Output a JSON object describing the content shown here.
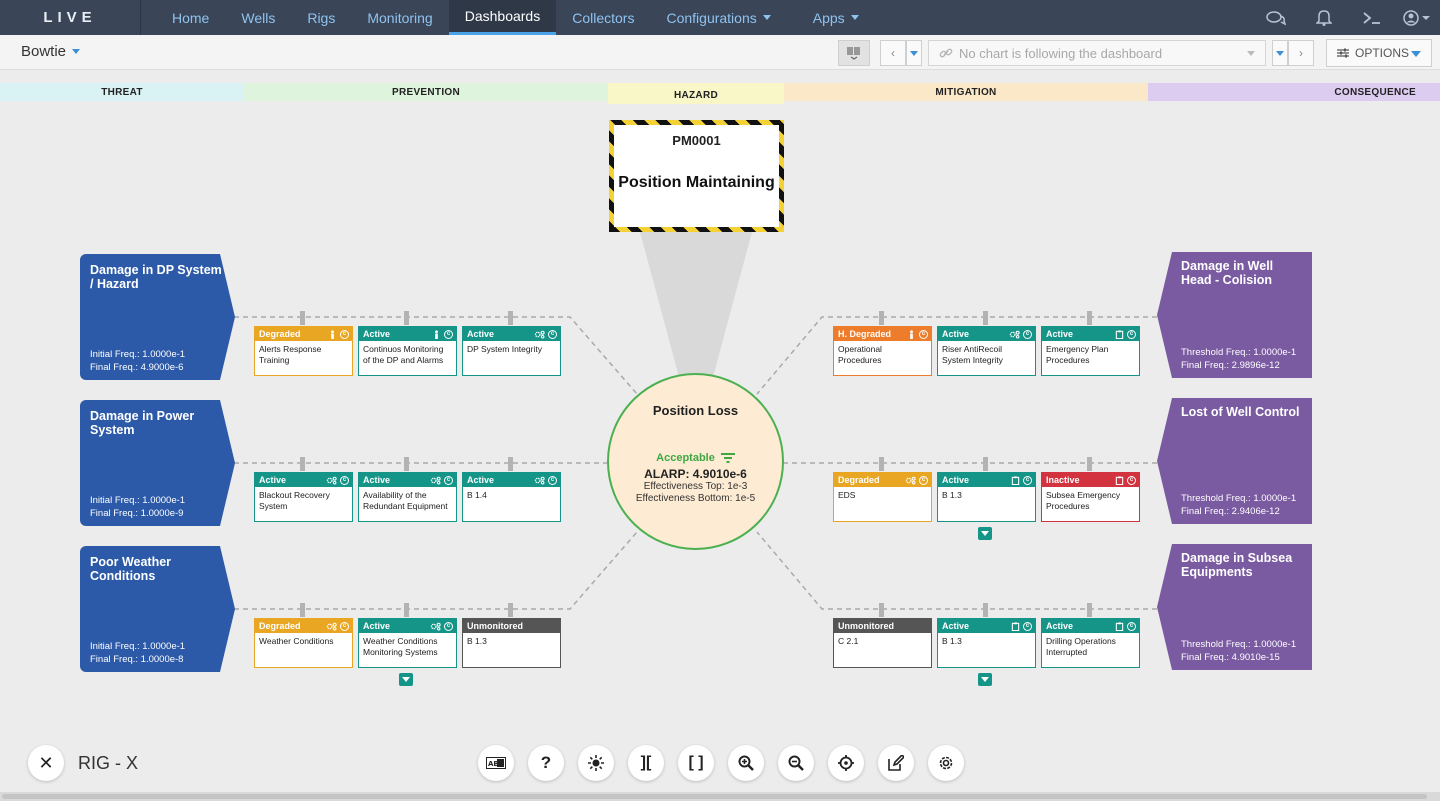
{
  "nav": {
    "logo": "LIVE",
    "items": [
      {
        "label": "Home"
      },
      {
        "label": "Wells"
      },
      {
        "label": "Rigs"
      },
      {
        "label": "Monitoring"
      },
      {
        "label": "Dashboards"
      },
      {
        "label": "Collectors"
      },
      {
        "label": "Configurations"
      },
      {
        "label": "Apps"
      }
    ]
  },
  "toolbar": {
    "dashboard_title": "Bowtie",
    "chart_select_placeholder": "No chart is following the dashboard",
    "options_label": "OPTIONS"
  },
  "categories": {
    "threat": "THREAT",
    "prevention": "PREVENTION",
    "hazard": "HAZARD",
    "mitigation": "MITIGATION",
    "consequence": "CONSEQUENCE"
  },
  "category_colors": {
    "threat": "#d9f3f5",
    "prevention": "#def4dc",
    "hazard": "#f9f6c8",
    "mitigation": "#fbe8c9",
    "consequence": "#dccdf0"
  },
  "hazard": {
    "code": "PM0001",
    "name": "Position Maintaining"
  },
  "top_event": {
    "title": "Position Loss",
    "status": "Acceptable",
    "alarp": "ALARP: 4.9010e-6",
    "eff_top": "Effectiveness Top: 1e-3",
    "eff_bottom": "Effectiveness Bottom: 1e-5"
  },
  "threats": [
    {
      "title": "Damage in DP System / Hazard",
      "initial": "Initial Freq.: 1.0000e-1",
      "final": "Final Freq.: 4.9000e-6"
    },
    {
      "title": "Damage in Power System",
      "initial": "Initial Freq.: 1.0000e-1",
      "final": "Final Freq.: 1.0000e-9"
    },
    {
      "title": "Poor Weather Conditions",
      "initial": "Initial Freq.: 1.0000e-1",
      "final": "Final Freq.: 1.0000e-8"
    }
  ],
  "consequences": [
    {
      "title": "Damage in Well Head - Colision",
      "threshold": "Threshold Freq.: 1.0000e-1",
      "final": "Final Freq.: 2.9896e-12"
    },
    {
      "title": "Lost of Well Control",
      "threshold": "Threshold Freq.: 1.0000e-1",
      "final": "Final Freq.: 2.9406e-12"
    },
    {
      "title": "Damage in Subsea Equipments",
      "threshold": "Threshold Freq.: 1.0000e-1",
      "final": "Final Freq.: 4.9010e-15"
    }
  ],
  "prevention_barriers": [
    [
      {
        "status": "Degraded",
        "label": "Alerts Response Training",
        "icon": "person-icon"
      },
      {
        "status": "Active",
        "label": "Continuos Monitoring of the DP and Alarms",
        "icon": "person-icon"
      },
      {
        "status": "Active",
        "label": "DP System Integrity",
        "icon": "gears-icon"
      }
    ],
    [
      {
        "status": "Active",
        "label": "Blackout Recovery System",
        "icon": "gears-icon"
      },
      {
        "status": "Active",
        "label": "Availability of the Redundant Equipment",
        "icon": "gears-icon"
      },
      {
        "status": "Active",
        "label": "B 1.4",
        "icon": "gears-icon"
      }
    ],
    [
      {
        "status": "Degraded",
        "label": "Weather Conditions",
        "icon": "gears-icon"
      },
      {
        "status": "Active",
        "label": "Weather Conditions Monitoring Systems",
        "icon": "gears-icon"
      },
      {
        "status": "Unmonitored",
        "label": "B 1.3",
        "icon": ""
      }
    ]
  ],
  "mitigation_barriers": [
    [
      {
        "status": "H. Degraded",
        "label": "Operational Procedures",
        "icon": "person-icon"
      },
      {
        "status": "Active",
        "label": "Riser AntiRecoil System Integrity",
        "icon": "gears-icon"
      },
      {
        "status": "Active",
        "label": "Emergency Plan Procedures",
        "icon": "clipboard-icon"
      }
    ],
    [
      {
        "status": "Degraded",
        "label": "EDS",
        "icon": "gears-icon"
      },
      {
        "status": "Active",
        "label": "B 1.3",
        "icon": "clipboard-icon"
      },
      {
        "status": "Inactive",
        "label": "Subsea Emergency Procedures",
        "icon": "clipboard-icon"
      }
    ],
    [
      {
        "status": "Unmonitored",
        "label": "C 2.1",
        "icon": ""
      },
      {
        "status": "Active",
        "label": "B 1.3",
        "icon": "clipboard-icon"
      },
      {
        "status": "Active",
        "label": "Drilling Operations Interrupted",
        "icon": "clipboard-icon"
      }
    ]
  ],
  "bottom": {
    "rig_label": "RIG - X",
    "tools": [
      "label-toggle-icon",
      "help-icon",
      "sun-icon",
      "collapse-icon",
      "expand-icon",
      "zoom-in-icon",
      "zoom-out-icon",
      "crosshair-icon",
      "edit-icon",
      "settings-icon"
    ]
  }
}
